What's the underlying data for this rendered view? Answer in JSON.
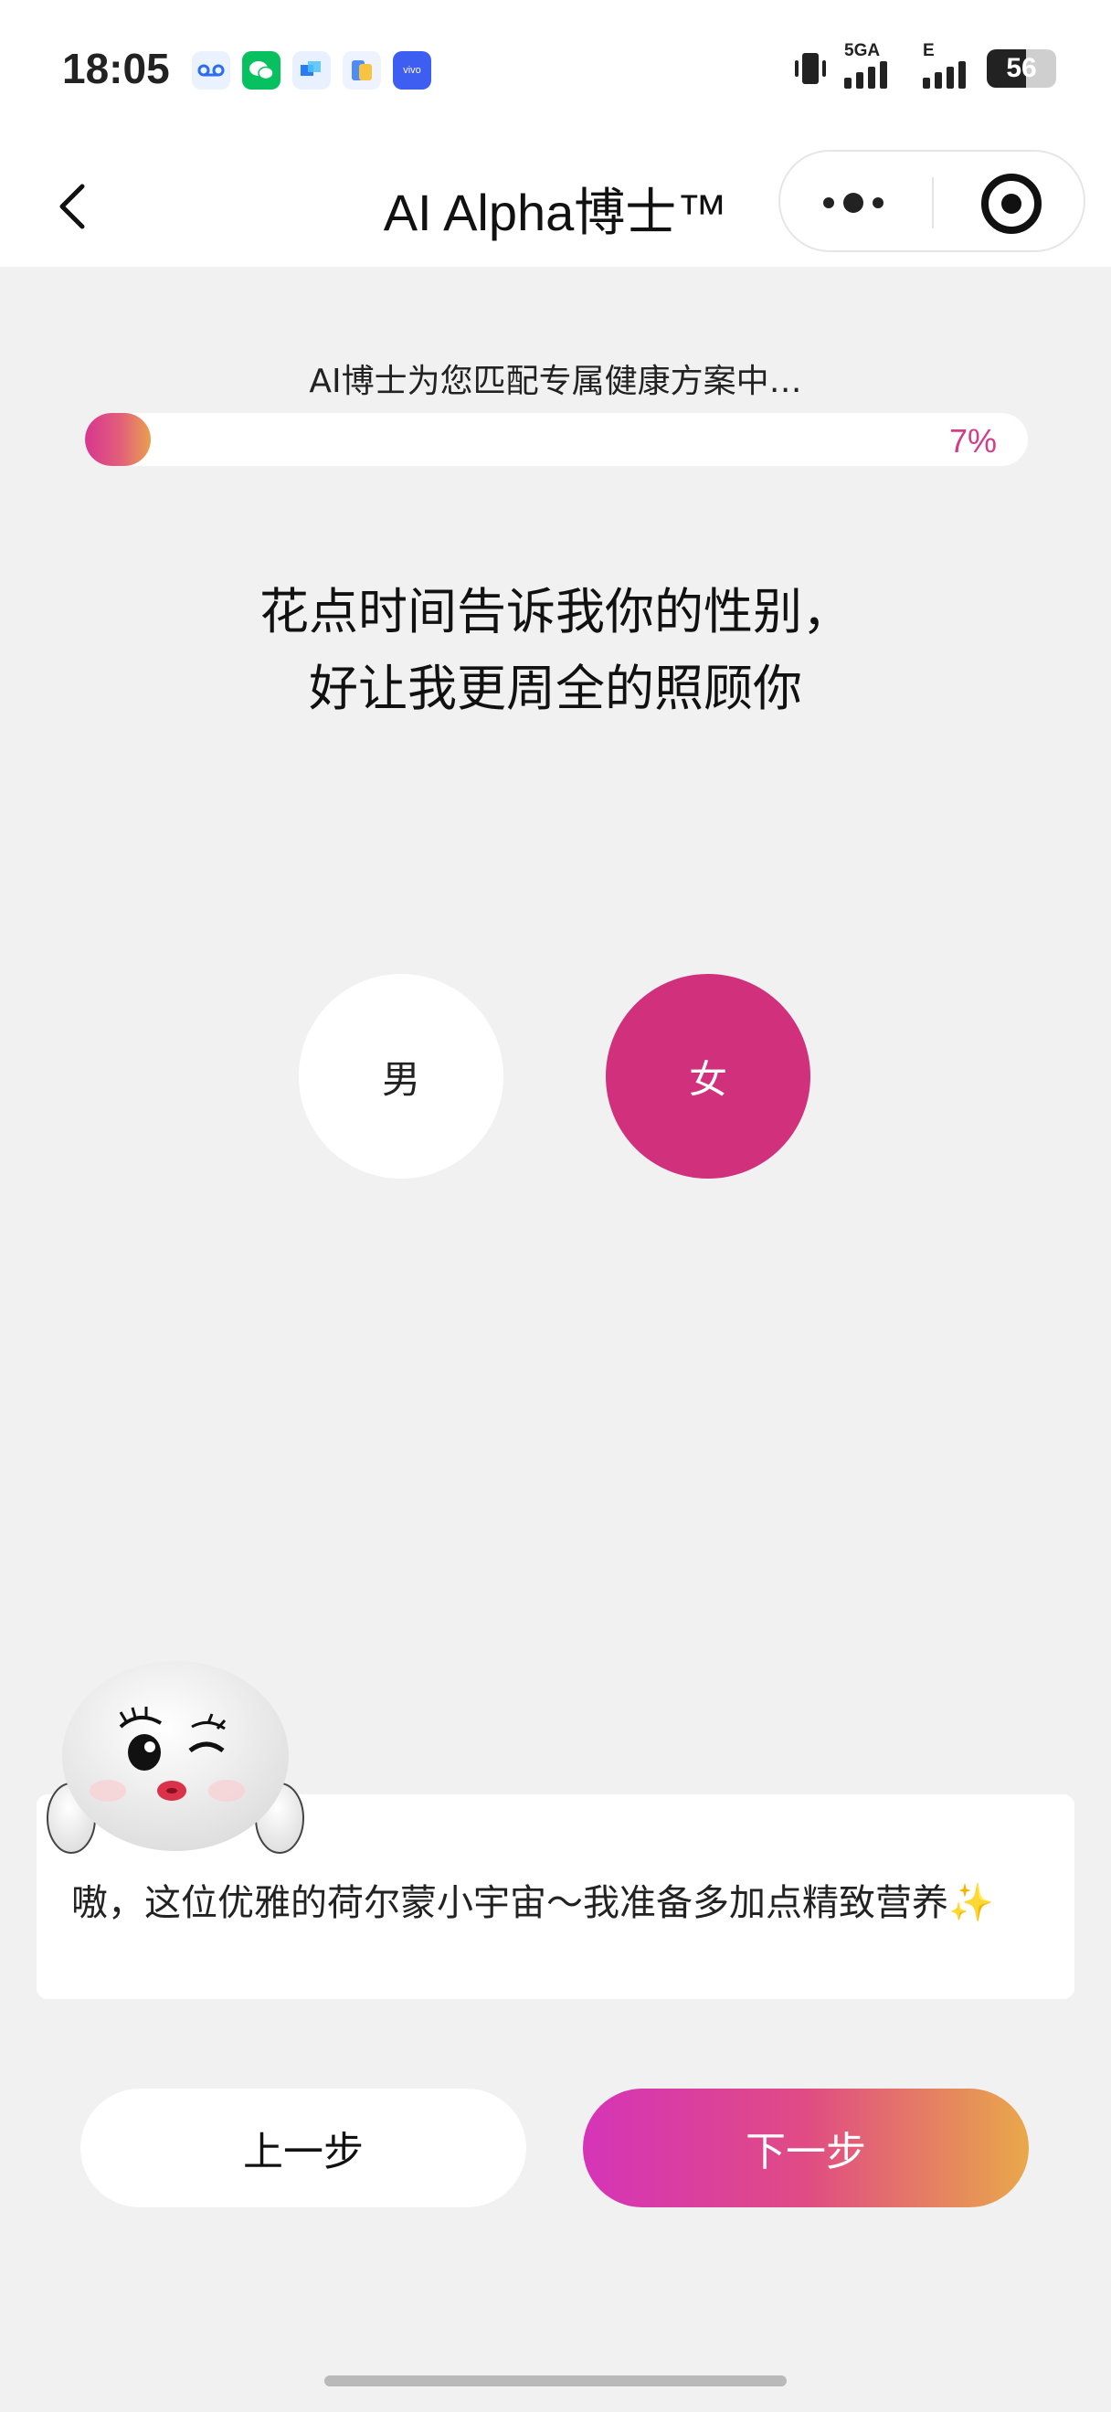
{
  "status_bar": {
    "time": "18:05",
    "notifications": [
      "voicemail-icon",
      "wechat-icon",
      "blue-app-icon",
      "files-icon",
      "vivo-icon"
    ],
    "vivo_label": "vivo",
    "network_1": "5GA",
    "network_2": "E",
    "battery": "56",
    "battery_level": 0.56
  },
  "header": {
    "title": "AI Alpha博士™",
    "back_icon": "chevron-left-icon",
    "more_icon": "more-dots-icon",
    "close_icon": "target-circle-icon"
  },
  "progress": {
    "caption": "AI博士为您匹配专属健康方案中…",
    "percent_label": "7%",
    "value": 0.07
  },
  "question": {
    "line1": "花点时间告诉我你的性别，",
    "line2": "好让我更周全的照顾你"
  },
  "options": {
    "male": "男",
    "female": "女",
    "selected": "female"
  },
  "speech": {
    "text": "嗷，这位优雅的荷尔蒙小宇宙～我准备多加点精致营养✨"
  },
  "buttons": {
    "prev": "上一步",
    "next": "下一步"
  },
  "colors": {
    "accent": "#d1307c",
    "gradient_start": "#d534b8",
    "gradient_end": "#e9a84a",
    "background": "#f1f1f1"
  }
}
